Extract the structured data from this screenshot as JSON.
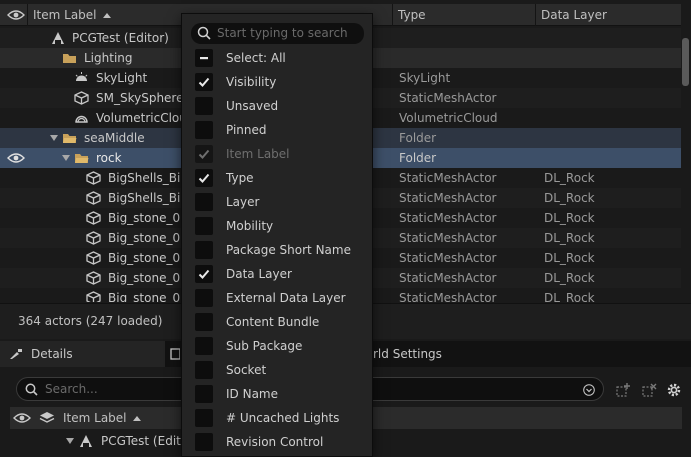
{
  "outliner": {
    "columns": {
      "label": "Item Label",
      "type": "Type",
      "data_layer": "Data Layer"
    },
    "rows": [
      {
        "label": "PCGTest (Editor)",
        "type": "",
        "data_layer": "",
        "icon": "level-icon"
      },
      {
        "label": "Lighting",
        "type": "",
        "data_layer": "",
        "icon": "folder-icon"
      },
      {
        "label": "SkyLight",
        "type": "SkyLight",
        "data_layer": "",
        "icon": "skylight-icon"
      },
      {
        "label": "SM_SkySphere",
        "type": "StaticMeshActor",
        "data_layer": "",
        "icon": "static-mesh-icon"
      },
      {
        "label": "VolumetricCloud",
        "type": "VolumetricCloud",
        "data_layer": "",
        "icon": "cloud-icon"
      },
      {
        "label": "seaMiddle",
        "type": "Folder",
        "data_layer": "",
        "icon": "folder-icon"
      },
      {
        "label": "rock",
        "type": "Folder",
        "data_layer": "",
        "icon": "folder-icon"
      },
      {
        "label": "BigShells_Bi",
        "type": "StaticMeshActor",
        "data_layer": "DL_Rock",
        "icon": "static-mesh-icon"
      },
      {
        "label": "BigShells_Bi",
        "type": "StaticMeshActor",
        "data_layer": "DL_Rock",
        "icon": "static-mesh-icon"
      },
      {
        "label": "Big_stone_0",
        "type": "StaticMeshActor",
        "data_layer": "DL_Rock",
        "icon": "static-mesh-icon"
      },
      {
        "label": "Big_stone_0",
        "type": "StaticMeshActor",
        "data_layer": "DL_Rock",
        "icon": "static-mesh-icon"
      },
      {
        "label": "Big_stone_0",
        "type": "StaticMeshActor",
        "data_layer": "DL_Rock",
        "icon": "static-mesh-icon"
      },
      {
        "label": "Big_stone_0",
        "type": "StaticMeshActor",
        "data_layer": "DL_Rock",
        "icon": "static-mesh-icon"
      },
      {
        "label": "Big_stone_0",
        "type": "StaticMeshActor",
        "data_layer": "DL_Rock",
        "icon": "static-mesh-icon"
      }
    ],
    "status": "364 actors (247 loaded)"
  },
  "bottom_panel": {
    "tabs": [
      "Details",
      "rld Settings"
    ],
    "search_placeholder": "Search...",
    "columns": {
      "label": "Item Label"
    },
    "row": "PCGTest (Edit"
  },
  "menu": {
    "search_placeholder": "Start typing to search",
    "items": [
      {
        "label": "Select: All",
        "state": "mixed"
      },
      {
        "label": "Visibility",
        "state": "checked"
      },
      {
        "label": "Unsaved",
        "state": "unchecked"
      },
      {
        "label": "Pinned",
        "state": "unchecked"
      },
      {
        "label": "Item Label",
        "state": "checked-disabled"
      },
      {
        "label": "Type",
        "state": "checked"
      },
      {
        "label": "Layer",
        "state": "unchecked"
      },
      {
        "label": "Mobility",
        "state": "unchecked"
      },
      {
        "label": "Package Short Name",
        "state": "unchecked"
      },
      {
        "label": "Data Layer",
        "state": "checked"
      },
      {
        "label": "External Data Layer",
        "state": "unchecked"
      },
      {
        "label": "Content Bundle",
        "state": "unchecked"
      },
      {
        "label": "Sub Package",
        "state": "unchecked"
      },
      {
        "label": "Socket",
        "state": "unchecked"
      },
      {
        "label": "ID Name",
        "state": "unchecked"
      },
      {
        "label": "# Uncached Lights",
        "state": "unchecked"
      },
      {
        "label": "Revision Control",
        "state": "unchecked"
      }
    ]
  },
  "colors": {
    "selection": "#3d4f68",
    "folder": "#c8a15a",
    "background": "#1a1a1a",
    "menu": "#242424"
  }
}
